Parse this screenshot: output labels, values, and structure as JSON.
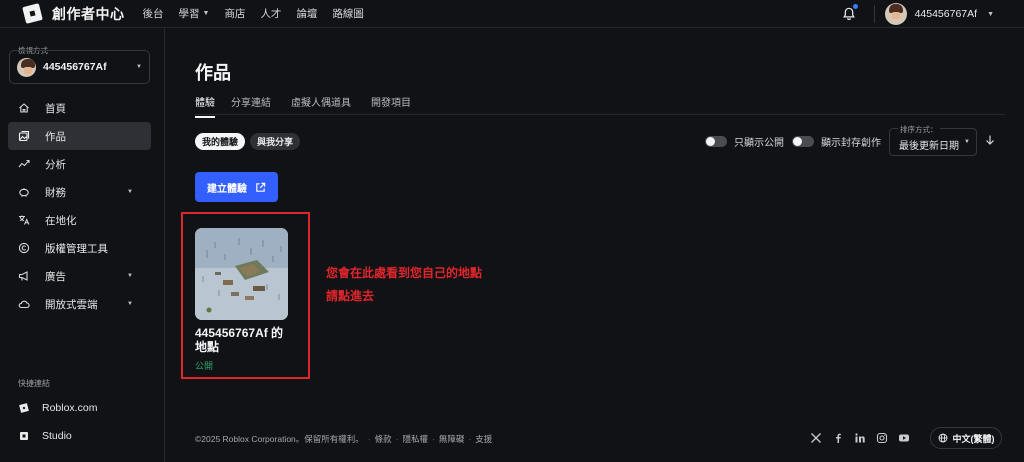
{
  "topbar": {
    "brand": "創作者中心",
    "nav": [
      {
        "label": "後台",
        "has_caret": false
      },
      {
        "label": "學習",
        "has_caret": true
      },
      {
        "label": "商店",
        "has_caret": false
      },
      {
        "label": "人才",
        "has_caret": false
      },
      {
        "label": "論壇",
        "has_caret": false
      },
      {
        "label": "路線圖",
        "has_caret": false
      }
    ],
    "username": "445456767Af",
    "notification_dot_color": "#3b7bff"
  },
  "sidebar": {
    "view_as_label": "檢視方式",
    "account_name": "445456767Af",
    "items": [
      {
        "label": "首頁",
        "icon": "home-icon",
        "has_caret": false,
        "active": false
      },
      {
        "label": "作品",
        "icon": "gallery-icon",
        "has_caret": false,
        "active": true
      },
      {
        "label": "分析",
        "icon": "chart-line-icon",
        "has_caret": false,
        "active": false
      },
      {
        "label": "財務",
        "icon": "piggy-bank-icon",
        "has_caret": true,
        "active": false
      },
      {
        "label": "在地化",
        "icon": "translate-icon",
        "has_caret": false,
        "active": false
      },
      {
        "label": "版權管理工具",
        "icon": "copyright-icon",
        "has_caret": false,
        "active": false
      },
      {
        "label": "廣告",
        "icon": "megaphone-icon",
        "has_caret": true,
        "active": false
      },
      {
        "label": "開放式雲端",
        "icon": "cloud-icon",
        "has_caret": true,
        "active": false
      }
    ],
    "quick_links_title": "快捷連結",
    "quick_links": [
      {
        "label": "Roblox.com",
        "icon": "roblox-icon"
      },
      {
        "label": "Studio",
        "icon": "studio-icon"
      }
    ]
  },
  "main": {
    "title": "作品",
    "tabs": [
      "體驗",
      "分享連結",
      "虛擬人偶道具",
      "開發項目"
    ],
    "active_tab": "體驗",
    "pills": [
      "我的體驗",
      "與我分享"
    ],
    "toggles": [
      "只顯示公開",
      "顯示封存創作"
    ],
    "sort": {
      "label": "排序方式：",
      "value": "最後更新日期"
    },
    "create_button": "建立體驗",
    "card": {
      "title": "445456767Af 的地點",
      "status": "公開"
    },
    "annotation": {
      "line1": "您會在此處看到您自己的地點",
      "line2": "請點進去"
    },
    "annotation_color": "#e0262b",
    "accent_color": "#335fff"
  },
  "footer": {
    "copyright": "©2025 Roblox Corporation。保留所有權利。",
    "links": [
      "條款",
      "隱私權",
      "無障礙",
      "支援"
    ],
    "social": [
      "x-icon",
      "facebook-icon",
      "linkedin-icon",
      "instagram-icon",
      "youtube-icon"
    ],
    "language": "中文(繁體)"
  }
}
